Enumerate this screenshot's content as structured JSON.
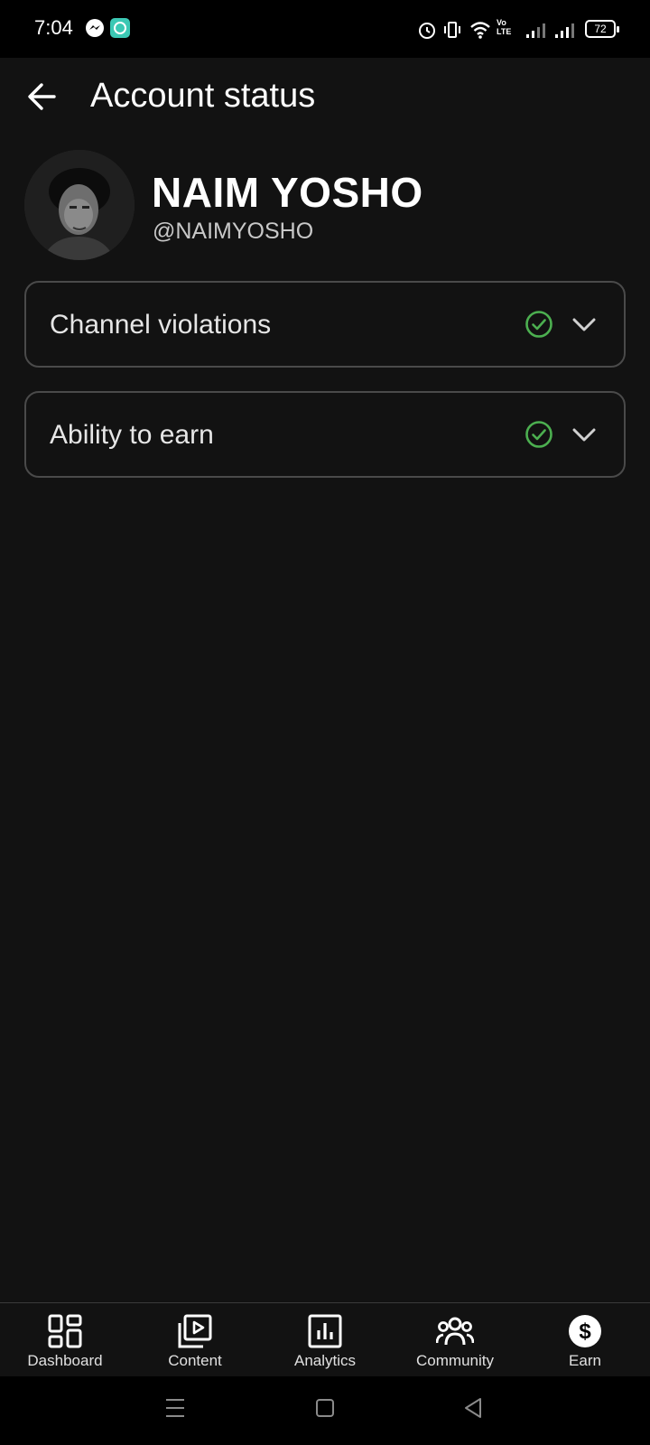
{
  "status_bar": {
    "time": "7:04",
    "battery": "72",
    "network_label": "Vo LTE",
    "icons": [
      "messenger-icon",
      "chat-app-icon",
      "alarm-icon",
      "vibrate-icon",
      "wifi-icon",
      "volte-icon",
      "signal-icon",
      "signal-icon",
      "battery-icon"
    ]
  },
  "header": {
    "title": "Account status",
    "back_icon": "arrow-left-icon"
  },
  "profile": {
    "name": "NAIM YOSHO",
    "handle": "@NAIMYOSHO"
  },
  "status_items": [
    {
      "label": "Channel violations",
      "status": "ok",
      "status_icon": "check-circle-icon",
      "expand_icon": "chevron-down-icon"
    },
    {
      "label": "Ability to earn",
      "status": "ok",
      "status_icon": "check-circle-icon",
      "expand_icon": "chevron-down-icon"
    }
  ],
  "bottom_nav": {
    "items": [
      {
        "label": "Dashboard",
        "icon": "dashboard-icon"
      },
      {
        "label": "Content",
        "icon": "content-icon"
      },
      {
        "label": "Analytics",
        "icon": "analytics-icon"
      },
      {
        "label": "Community",
        "icon": "community-icon"
      },
      {
        "label": "Earn",
        "icon": "earn-icon",
        "active": true
      }
    ]
  },
  "colors": {
    "background": "#121212",
    "status_ok": "#4caf50",
    "border": "#4a4a4a",
    "text_secondary": "#c8c8c8"
  }
}
